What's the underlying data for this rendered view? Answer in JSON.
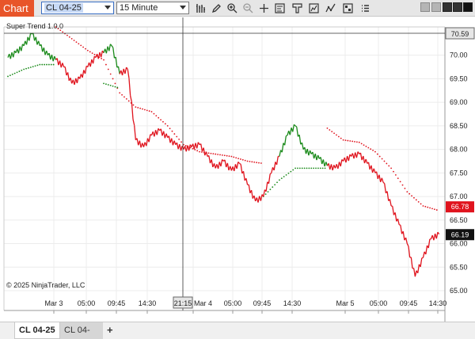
{
  "toolbar": {
    "window_title": "Chart",
    "instrument": "CL 04-25",
    "interval": "15 Minute",
    "icons": [
      "bar-type-icon",
      "pencil-icon",
      "zoom-in-icon",
      "zoom-out-icon",
      "crosshair-icon",
      "data-box-icon",
      "properties-icon",
      "strategies-icon",
      "indicators-icon",
      "templates-icon",
      "menu-icon"
    ]
  },
  "indicator_label": "Super Trend 1.0.0",
  "copyright": "© 2025 NinjaTrader, LLC",
  "colors": {
    "up": "#1a8a1a",
    "down": "#e0141e",
    "last_price_bg": "#111111",
    "trend_price_bg": "#e0141e"
  },
  "chart_data": {
    "type": "line",
    "y_ticks": [
      "70.00",
      "69.50",
      "69.00",
      "68.50",
      "68.00",
      "67.50",
      "67.00",
      "66.50",
      "66.00",
      "65.50",
      "65.00"
    ],
    "x_ticks": [
      "Mar 3",
      "05:00",
      "09:45",
      "14:30",
      "21:15 Mar 4",
      "05:00",
      "09:45",
      "14:30",
      "Mar 5",
      "05:00",
      "09:45",
      "14:30"
    ],
    "crosshair_x_label": "21:15",
    "crosshair_y_label": "70.59",
    "trend_label": "66.78",
    "last_price_label": "66.19",
    "ylim": [
      64.95,
      70.6
    ],
    "grid": true,
    "price": [
      [
        0,
        69.95
      ],
      [
        3,
        70.05
      ],
      [
        6,
        70.2
      ],
      [
        9,
        70.45
      ],
      [
        12,
        70.2
      ],
      [
        15,
        70.0
      ],
      [
        18,
        69.9
      ],
      [
        21,
        69.75
      ],
      [
        24,
        69.4
      ],
      [
        27,
        69.5
      ],
      [
        30,
        69.75
      ],
      [
        33,
        69.95
      ],
      [
        36,
        70.05
      ],
      [
        39,
        70.2
      ],
      [
        42,
        69.6
      ],
      [
        45,
        69.7
      ],
      [
        48,
        68.2
      ],
      [
        51,
        68.05
      ],
      [
        54,
        68.3
      ],
      [
        57,
        68.4
      ],
      [
        60,
        68.25
      ],
      [
        63,
        68.1
      ],
      [
        66,
        68.0
      ],
      [
        69,
        68.05
      ],
      [
        72,
        68.1
      ],
      [
        75,
        67.85
      ],
      [
        78,
        67.6
      ],
      [
        81,
        67.75
      ],
      [
        84,
        67.55
      ],
      [
        87,
        67.7
      ],
      [
        90,
        67.25
      ],
      [
        93,
        66.9
      ],
      [
        96,
        67.0
      ],
      [
        99,
        67.5
      ],
      [
        102,
        67.85
      ],
      [
        105,
        68.3
      ],
      [
        108,
        68.5
      ],
      [
        111,
        68.0
      ],
      [
        114,
        67.9
      ],
      [
        117,
        67.8
      ],
      [
        120,
        67.65
      ],
      [
        123,
        67.6
      ],
      [
        126,
        67.75
      ],
      [
        129,
        67.85
      ],
      [
        132,
        67.9
      ],
      [
        135,
        67.7
      ],
      [
        138,
        67.5
      ],
      [
        141,
        67.3
      ],
      [
        144,
        66.8
      ],
      [
        147,
        66.4
      ],
      [
        150,
        66.0
      ],
      [
        153,
        65.3
      ],
      [
        156,
        65.7
      ],
      [
        159,
        66.1
      ],
      [
        162,
        66.2
      ]
    ],
    "price_up_ranges": [
      [
        0,
        18
      ],
      [
        36,
        42
      ],
      [
        102,
        120
      ]
    ],
    "trend_down": [
      [
        18,
        70.6
      ],
      [
        24,
        70.35
      ],
      [
        30,
        70.1
      ],
      [
        36,
        69.9
      ],
      [
        42,
        69.2
      ],
      [
        48,
        68.9
      ],
      [
        54,
        68.8
      ],
      [
        60,
        68.5
      ],
      [
        66,
        68.1
      ],
      [
        72,
        67.95
      ],
      [
        78,
        67.9
      ],
      [
        84,
        67.85
      ],
      [
        90,
        67.75
      ],
      [
        96,
        67.7
      ],
      [
        120,
        68.45
      ],
      [
        126,
        68.2
      ],
      [
        132,
        68.15
      ],
      [
        138,
        67.95
      ],
      [
        144,
        67.6
      ],
      [
        150,
        67.1
      ],
      [
        156,
        66.8
      ],
      [
        162,
        66.7
      ]
    ],
    "trend_up": [
      [
        0,
        69.55
      ],
      [
        6,
        69.7
      ],
      [
        12,
        69.8
      ],
      [
        18,
        69.8
      ],
      [
        36,
        69.4
      ],
      [
        42,
        69.3
      ],
      [
        96,
        67.0
      ],
      [
        102,
        67.35
      ],
      [
        108,
        67.6
      ],
      [
        114,
        67.6
      ],
      [
        120,
        67.6
      ]
    ],
    "x_max": 163
  }
}
